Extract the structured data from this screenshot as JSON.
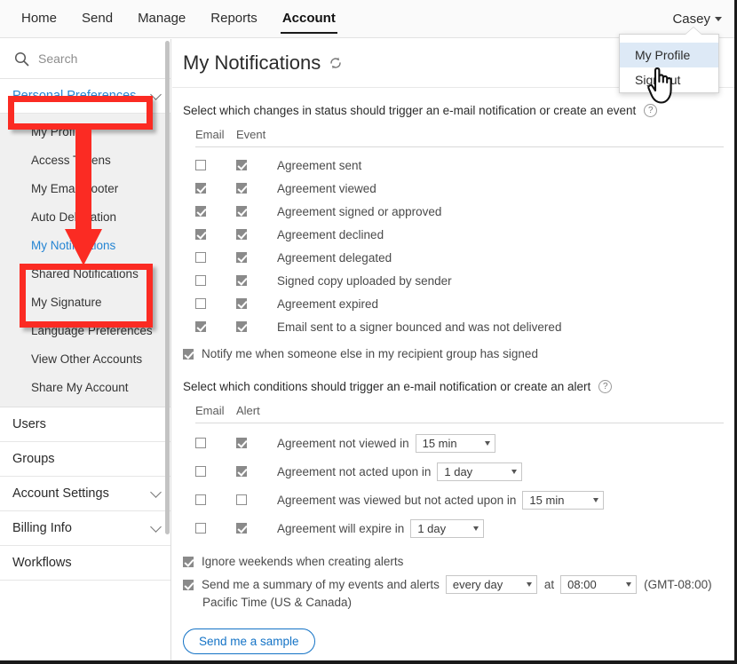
{
  "topnav": {
    "items": [
      {
        "label": "Home",
        "active": false
      },
      {
        "label": "Send",
        "active": false
      },
      {
        "label": "Manage",
        "active": false
      },
      {
        "label": "Reports",
        "active": false
      },
      {
        "label": "Account",
        "active": true
      }
    ],
    "user_label": "Casey",
    "caret_icon": "chevron-down-icon"
  },
  "user_menu": {
    "items": [
      {
        "label": "My Profile",
        "highlighted": true
      },
      {
        "label": "Sign out",
        "highlighted": false
      }
    ]
  },
  "sidebar": {
    "search": {
      "placeholder": "Search",
      "icon": "search-icon"
    },
    "groups": [
      {
        "label": "Personal Preferences",
        "open": true,
        "items": [
          {
            "label": "My Profile",
            "selected": false
          },
          {
            "label": "Access Tokens",
            "selected": false
          },
          {
            "label": "My Email Footer",
            "selected": false
          },
          {
            "label": "Auto Delegation",
            "selected": false
          },
          {
            "label": "My Notifications",
            "selected": true
          },
          {
            "label": "Shared Notifications",
            "selected": false
          },
          {
            "label": "My Signature",
            "selected": false
          },
          {
            "label": "Language Preferences",
            "selected": false
          },
          {
            "label": "View Other Accounts",
            "selected": false
          },
          {
            "label": "Share My Account",
            "selected": false
          }
        ]
      },
      {
        "label": "Users",
        "open": false,
        "has_chevron": false,
        "items": []
      },
      {
        "label": "Groups",
        "open": false,
        "has_chevron": false,
        "items": []
      },
      {
        "label": "Account Settings",
        "open": false,
        "has_chevron": true,
        "items": []
      },
      {
        "label": "Billing Info",
        "open": false,
        "has_chevron": true,
        "items": []
      },
      {
        "label": "Workflows",
        "open": false,
        "has_chevron": false,
        "items": []
      }
    ]
  },
  "main": {
    "page_title": "My Notifications",
    "refresh_icon": "refresh-icon",
    "events_section": {
      "heading": "Select which changes in status should trigger an e-mail notification or create an event",
      "help_icon": "help-icon",
      "columns": [
        "Email",
        "Event"
      ],
      "rows": [
        {
          "label": "Agreement sent",
          "email": false,
          "event": true
        },
        {
          "label": "Agreement viewed",
          "email": true,
          "event": true
        },
        {
          "label": "Agreement signed or approved",
          "email": true,
          "event": true
        },
        {
          "label": "Agreement declined",
          "email": true,
          "event": true
        },
        {
          "label": "Agreement delegated",
          "email": false,
          "event": true
        },
        {
          "label": "Signed copy uploaded by sender",
          "email": false,
          "event": true
        },
        {
          "label": "Agreement expired",
          "email": false,
          "event": true
        },
        {
          "label": "Email sent to a signer bounced and was not delivered",
          "email": true,
          "event": true
        }
      ],
      "notify_group": {
        "label": "Notify me when someone else in my recipient group has signed",
        "checked": true
      }
    },
    "alerts_section": {
      "heading": "Select which conditions should trigger an e-mail notification or create an alert",
      "help_icon": "help-icon",
      "columns": [
        "Email",
        "Alert"
      ],
      "rows": [
        {
          "label": "Agreement not viewed in",
          "email": false,
          "alert": true,
          "select_value": "15 min",
          "select_width": 90
        },
        {
          "label": "Agreement not acted upon in",
          "email": false,
          "alert": true,
          "select_value": "1 day",
          "select_width": 96
        },
        {
          "label": "Agreement was viewed but not acted upon in",
          "email": false,
          "alert": false,
          "select_value": "15 min",
          "select_width": 92
        },
        {
          "label": "Agreement will expire in",
          "email": false,
          "alert": true,
          "select_value": "1 day",
          "select_width": 83
        }
      ]
    },
    "footer": {
      "ignore_weekends": {
        "label": "Ignore weekends when creating alerts",
        "checked": true
      },
      "summary": {
        "label": "Send me a summary of my events and alerts",
        "checked": true,
        "frequency_value": "every day",
        "at_label": "at",
        "time_value": "08:00",
        "timezone_offset": "(GMT-08:00)",
        "timezone_name": "Pacific Time (US & Canada)"
      },
      "sample_button": "Send me a sample"
    }
  },
  "annotations": {
    "accent_color": "#fb2b23",
    "shapes": [
      "highlight-box-personal-preferences",
      "arrow-down",
      "highlight-box-notifications"
    ]
  }
}
